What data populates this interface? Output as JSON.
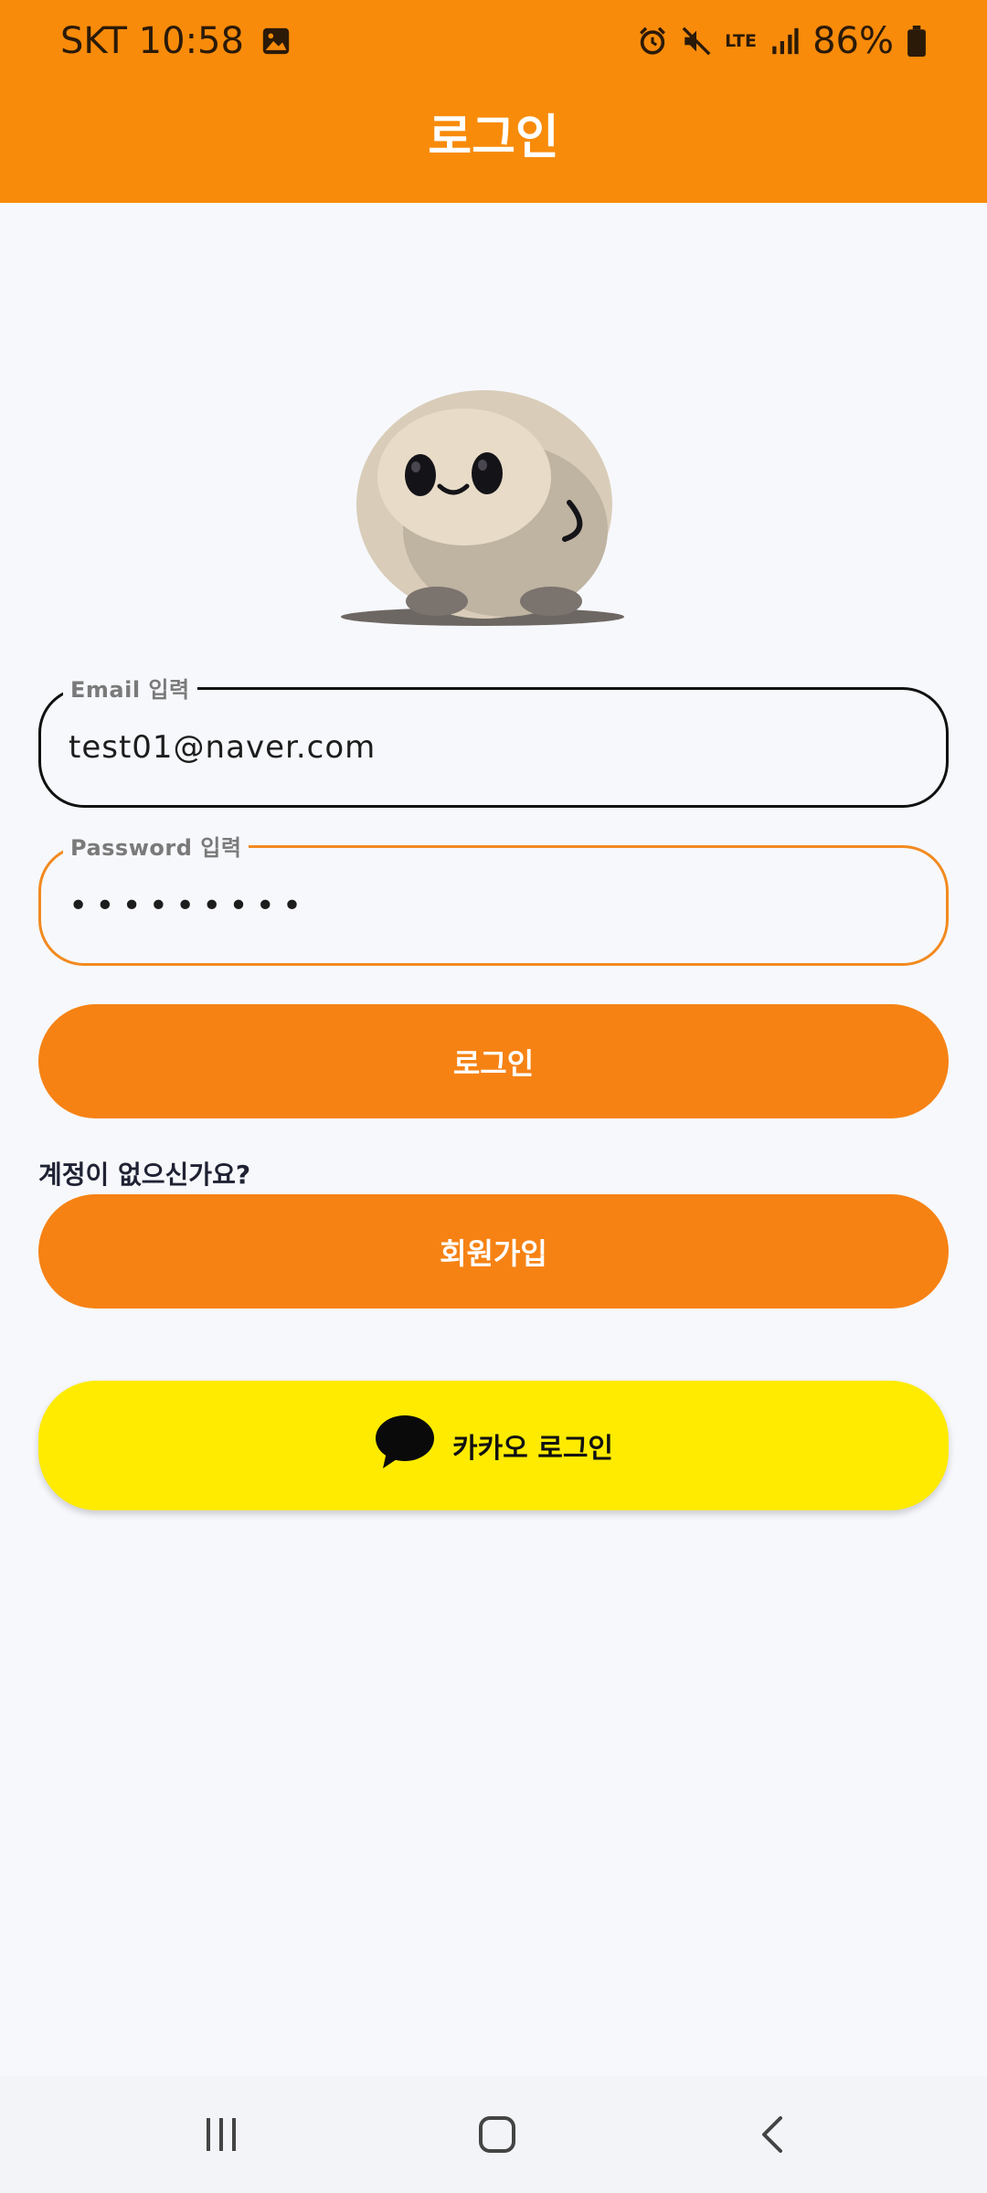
{
  "status_bar": {
    "carrier_time": "SKT 10:58",
    "network": "LTE",
    "battery": "86%",
    "icons": [
      "gallery-icon",
      "alarm-icon",
      "mute-icon",
      "lte-icon",
      "signal-icon",
      "battery-icon"
    ]
  },
  "app_bar": {
    "title": "로그인"
  },
  "form": {
    "email_label": "Email 입력",
    "email_value": "test01@naver.com",
    "password_label": "Password 입력",
    "password_value": "•••••••••"
  },
  "buttons": {
    "login": "로그인",
    "signup_prompt": "계정이 없으신가요?",
    "signup": "회원가입",
    "kakao_login": "카카오 로그인"
  },
  "nav_bar": {
    "icons": [
      "recent-apps-icon",
      "home-icon",
      "back-icon"
    ]
  },
  "colors": {
    "primary": "#f88b0a",
    "button": "#f68214",
    "kakao_yellow": "#feeb00",
    "background": "#f7f8fc",
    "focus_border": "#f28a1f"
  }
}
